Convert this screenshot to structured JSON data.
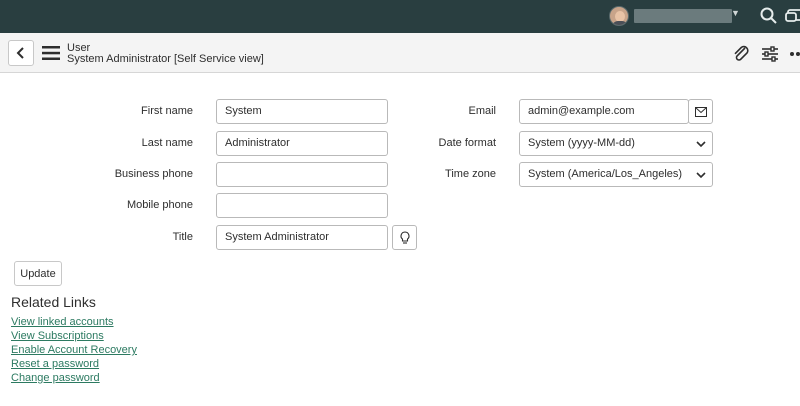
{
  "topbar": {
    "icons": [
      "avatar",
      "search-icon",
      "chat-icon"
    ]
  },
  "header": {
    "title": "User",
    "subtitle": "System Administrator [Self Service view]",
    "icons": [
      "back-icon",
      "menu-icon",
      "attachment-icon",
      "settings-sliders-icon",
      "more-icon"
    ]
  },
  "form": {
    "left": [
      {
        "label": "First name",
        "value": "System"
      },
      {
        "label": "Last name",
        "value": "Administrator"
      },
      {
        "label": "Business phone",
        "value": ""
      },
      {
        "label": "Mobile phone",
        "value": ""
      },
      {
        "label": "Title",
        "value": "System Administrator"
      }
    ],
    "right": [
      {
        "label": "Email",
        "value": "admin@example.com"
      },
      {
        "label": "Date format",
        "value": "System (yyyy-MM-dd)"
      },
      {
        "label": "Time zone",
        "value": "System (America/Los_Angeles)"
      }
    ]
  },
  "update_label": "Update",
  "related": {
    "title": "Related Links",
    "links": [
      "View linked accounts",
      "View Subscriptions",
      "Enable Account Recovery",
      "Reset a password",
      "Change password"
    ]
  },
  "colors": {
    "topbar": "#293e40",
    "link": "#2c7a61",
    "header_bg": "#f4f4f4"
  }
}
